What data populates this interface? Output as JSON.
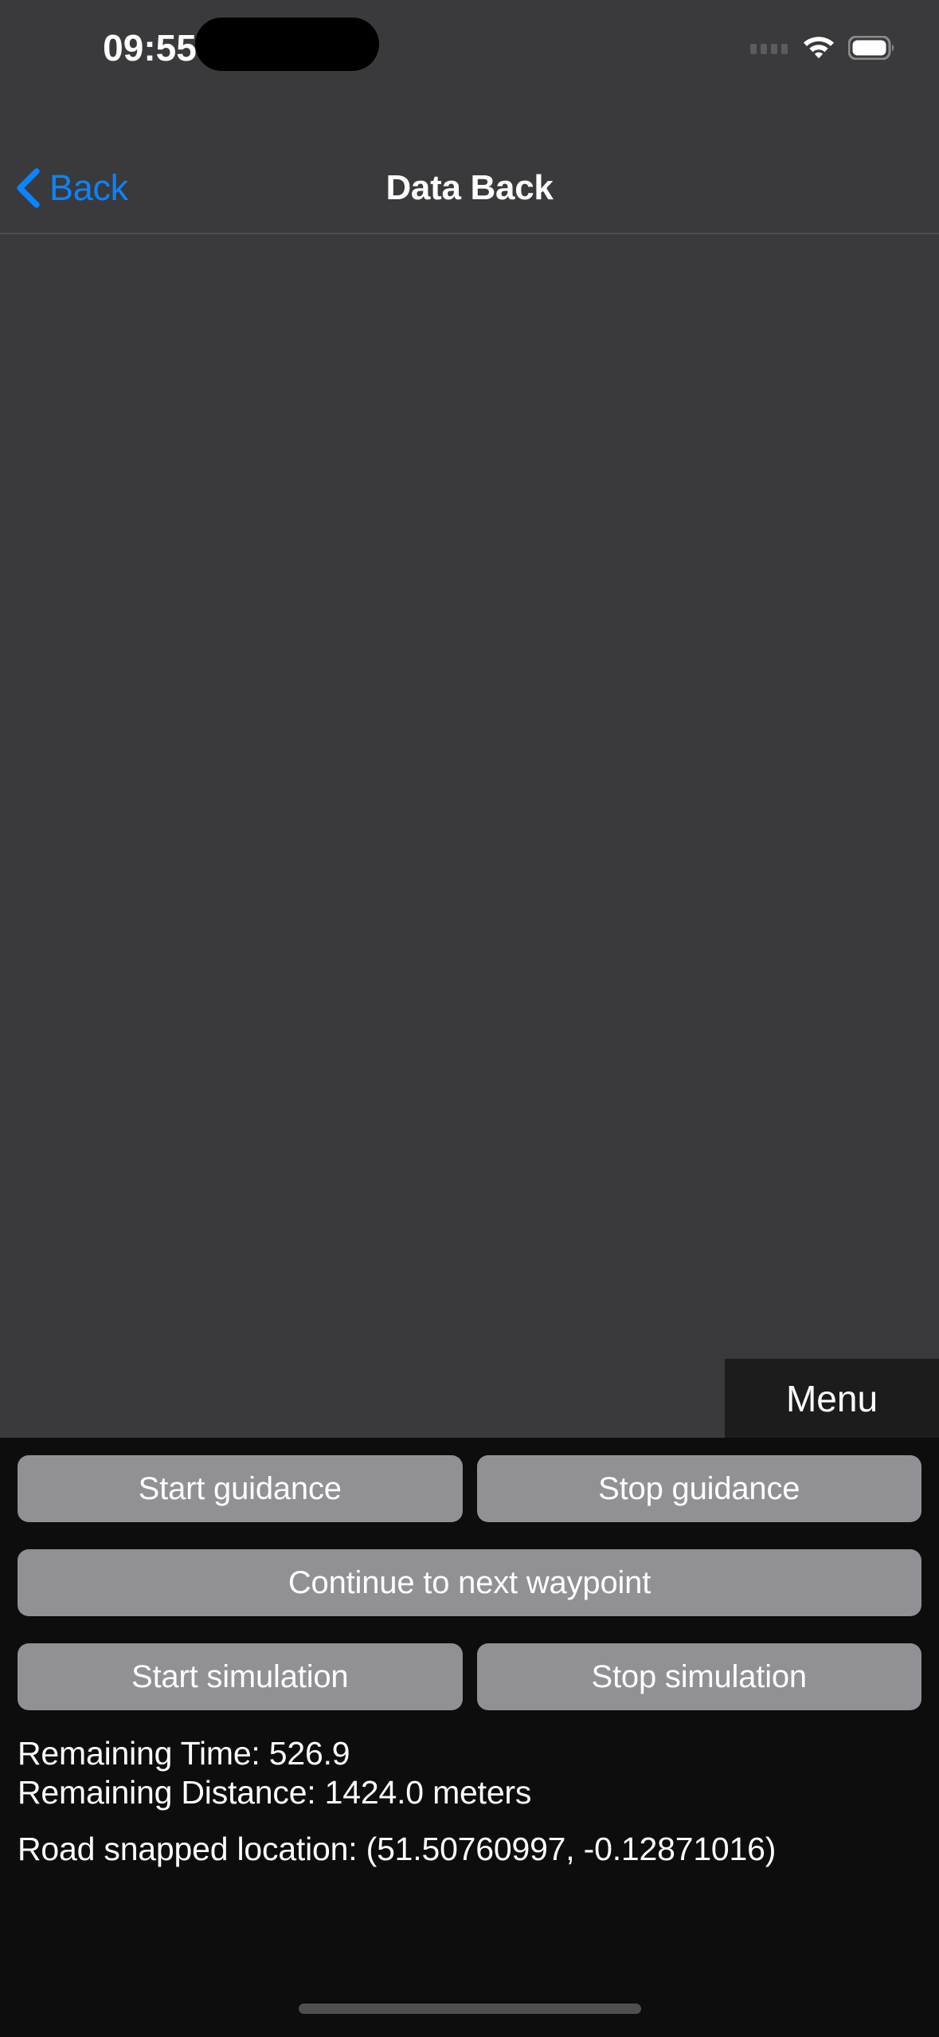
{
  "status_bar": {
    "time": "09:55",
    "icons": {
      "cellular": "cellular-dots-icon",
      "wifi": "wifi-icon",
      "battery": "battery-full-icon"
    }
  },
  "nav_bar": {
    "back_label": "Back",
    "back_icon": "chevron-left-icon",
    "title": "Data Back"
  },
  "map": {
    "menu_label": "Menu"
  },
  "controls": {
    "start_guidance_label": "Start guidance",
    "stop_guidance_label": "Stop guidance",
    "continue_waypoint_label": "Continue to next waypoint",
    "start_simulation_label": "Start simulation",
    "stop_simulation_label": "Stop simulation"
  },
  "info": {
    "remaining_time": "Remaining Time: 526.9",
    "remaining_distance": "Remaining Distance: 1424.0 meters",
    "road_snapped_location": "Road snapped location: (51.50760997, -0.12871016)"
  },
  "colors": {
    "accent_blue": "#0a84ff",
    "nav_background": "#3a3a3c",
    "map_background": "#3a3a3c",
    "panel_background": "#0d0d0d",
    "button_gray": "#909095",
    "menu_background": "#1c1c1c"
  }
}
